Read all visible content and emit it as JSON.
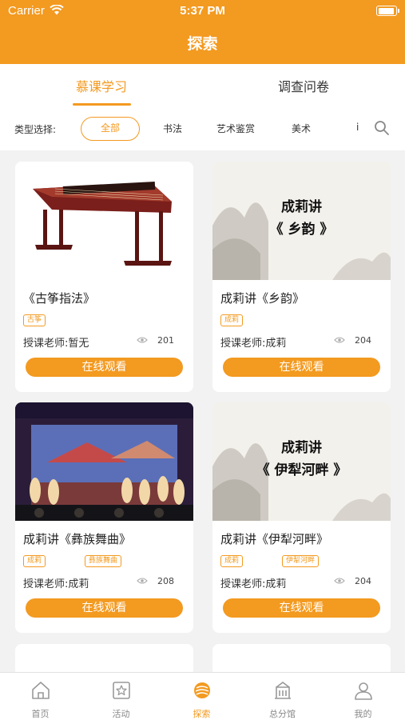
{
  "status_bar": {
    "carrier": "Carrier",
    "time": "5:37 PM"
  },
  "nav": {
    "title": "探索"
  },
  "tabs": [
    {
      "label": "慕课学习"
    },
    {
      "label": "调查问卷"
    }
  ],
  "filter": {
    "label": "类型选择:",
    "options": [
      "全部",
      "书法",
      "艺术鉴赏",
      "美术",
      "i"
    ],
    "selected": "全部"
  },
  "courses": [
    {
      "title": "《古筝指法》",
      "tags": [
        "古筝"
      ],
      "teacher": "授课老师:暂无",
      "views": "201",
      "button": "在线观看"
    },
    {
      "title": "成莉讲《乡韵》",
      "tags": [
        "成莉"
      ],
      "teacher": "授课老师:成莉",
      "views": "204",
      "button": "在线观看",
      "cover_text": [
        "成莉讲",
        "《 乡韵 》"
      ]
    },
    {
      "title": "成莉讲《彝族舞曲》",
      "tags": [
        "成莉",
        "彝族舞曲"
      ],
      "teacher": "授课老师:成莉",
      "views": "208",
      "button": "在线观看"
    },
    {
      "title": "成莉讲《伊犁河畔》",
      "tags": [
        "成莉",
        "伊犁河畔"
      ],
      "teacher": "授课老师:成莉",
      "views": "204",
      "button": "在线观看",
      "cover_text": [
        "成莉讲",
        "《 伊犁河畔 》"
      ]
    }
  ],
  "tabbar": [
    {
      "label": "首页",
      "icon": "home-icon"
    },
    {
      "label": "活动",
      "icon": "activity-icon"
    },
    {
      "label": "探索",
      "icon": "explore-icon",
      "active": true
    },
    {
      "label": "总分馆",
      "icon": "library-icon"
    },
    {
      "label": "我的",
      "icon": "profile-icon"
    }
  ],
  "colors": {
    "accent": "#f39a20",
    "background": "#f2f2f2"
  }
}
